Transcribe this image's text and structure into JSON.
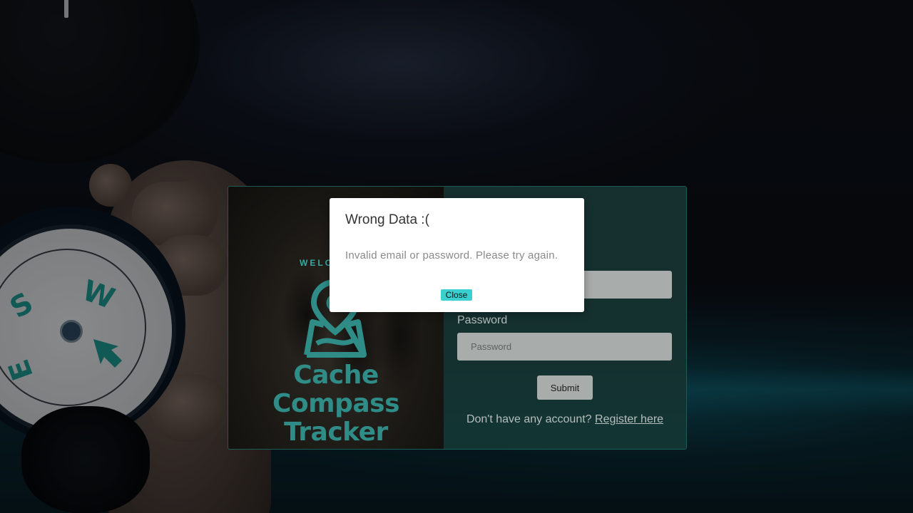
{
  "background": {
    "accent_color": "#2f8c87"
  },
  "card": {
    "left": {
      "welcome_text": "WELC",
      "brand_line1": "Cache Compass",
      "brand_line2": "Tracker",
      "logo_icon": "map-pin-icon"
    },
    "form": {
      "email_value": "",
      "password_label": "Password",
      "password_placeholder": "Password",
      "submit_label": "Submit",
      "register_prompt": "Don't have any account?",
      "register_link": "Register here"
    }
  },
  "modal": {
    "title": "Wrong Data :(",
    "message": "Invalid email or password. Please try again.",
    "close_label": "Close",
    "close_color": "#3ad0d0"
  }
}
